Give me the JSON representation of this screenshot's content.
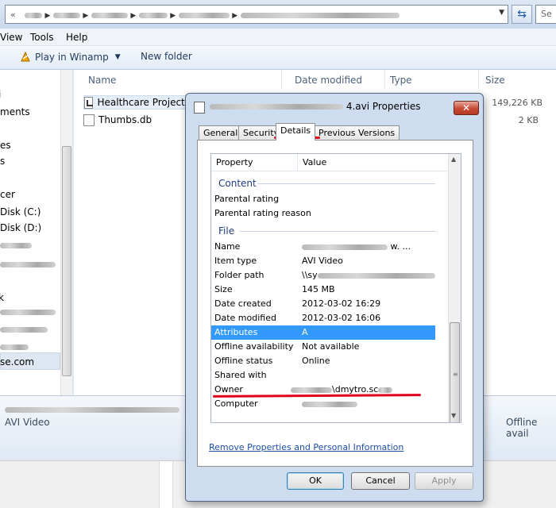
{
  "explorer": {
    "address_back": "«",
    "search_placeholder": "Se",
    "menu": [
      "View",
      "Tools",
      "Help"
    ],
    "toolbar": {
      "play": "Play in Winamp",
      "play_caret": "▼",
      "new_folder": "New folder"
    },
    "nav_items": [
      "ments",
      "es",
      "s",
      "cer",
      "Disk (C:)",
      "Disk (D:)",
      "se.com"
    ],
    "columns": [
      "Name",
      "Date modified",
      "Type",
      "Size"
    ],
    "files": [
      {
        "name": "Healthcare Projects",
        "size": "149,226 KB"
      },
      {
        "name": "Thumbs.db",
        "size": "2 KB"
      }
    ],
    "details_pane": {
      "type": "AVI Video",
      "offline": "Offline avail"
    }
  },
  "dialog": {
    "title_suffix": "4.avi Properties",
    "close_label": "✕",
    "tabs": [
      "General",
      "Security",
      "Details",
      "Previous Versions"
    ],
    "headers": {
      "property": "Property",
      "value": "Value"
    },
    "sections": {
      "content": "Content",
      "file": "File"
    },
    "content_rows": [
      {
        "prop": "Parental rating",
        "value": ""
      },
      {
        "prop": "Parental rating reason",
        "value": ""
      }
    ],
    "file_rows": [
      {
        "prop": "Name",
        "value": "w. ..."
      },
      {
        "prop": "Item type",
        "value": "AVI Video"
      },
      {
        "prop": "Folder path",
        "value": "\\\\sy"
      },
      {
        "prop": "Size",
        "value": "145 MB"
      },
      {
        "prop": "Date created",
        "value": "2012-03-02 16:29"
      },
      {
        "prop": "Date modified",
        "value": "2012-03-02 16:06"
      },
      {
        "prop": "Attributes",
        "value": "A"
      },
      {
        "prop": "Offline availability",
        "value": "Not available"
      },
      {
        "prop": "Offline status",
        "value": "Online"
      },
      {
        "prop": "Shared with",
        "value": ""
      },
      {
        "prop": "Owner",
        "value": "\\dmytro.sc"
      },
      {
        "prop": "Computer",
        "value": ""
      }
    ],
    "remove_link": "Remove Properties and Personal Information",
    "buttons": {
      "ok": "OK",
      "cancel": "Cancel",
      "apply": "Apply"
    },
    "highlight_color": "#3399ff",
    "annotation_color": "#e2001a"
  }
}
